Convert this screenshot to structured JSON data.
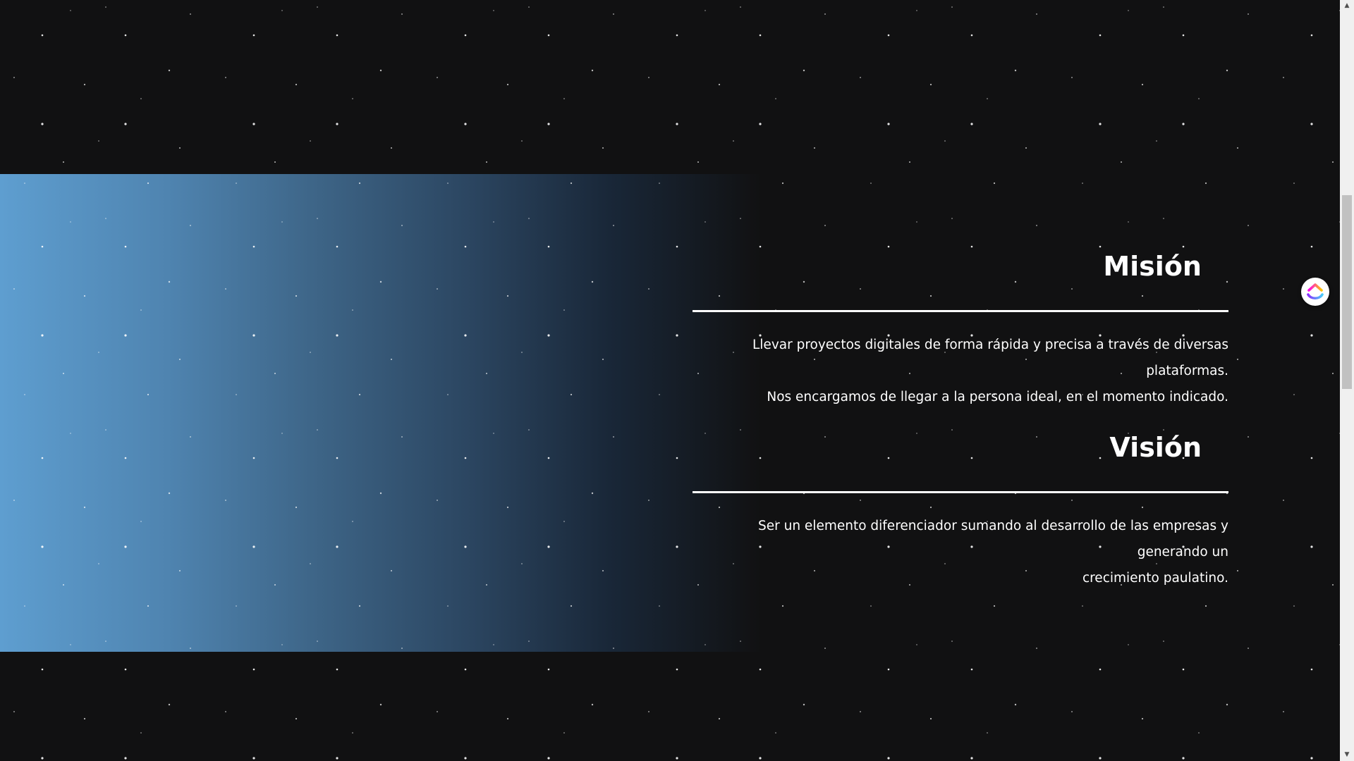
{
  "sections": [
    {
      "title": "Misión",
      "lines": [
        "Llevar proyectos digitales de forma rápida y precisa a través de diversas plataformas.",
        "Nos encargamos de llegar a la persona ideal, en el momento indicado."
      ]
    },
    {
      "title": "Visión",
      "lines": [
        "Ser un elemento diferenciador sumando al desarrollo de las empresas y generando un",
        "crecimiento paulatino."
      ]
    }
  ],
  "widget": {
    "icon": "clickup-logo-icon"
  },
  "colors": {
    "background": "#111112",
    "gradient_start": "#5e9ed0",
    "text": "#ffffff"
  }
}
